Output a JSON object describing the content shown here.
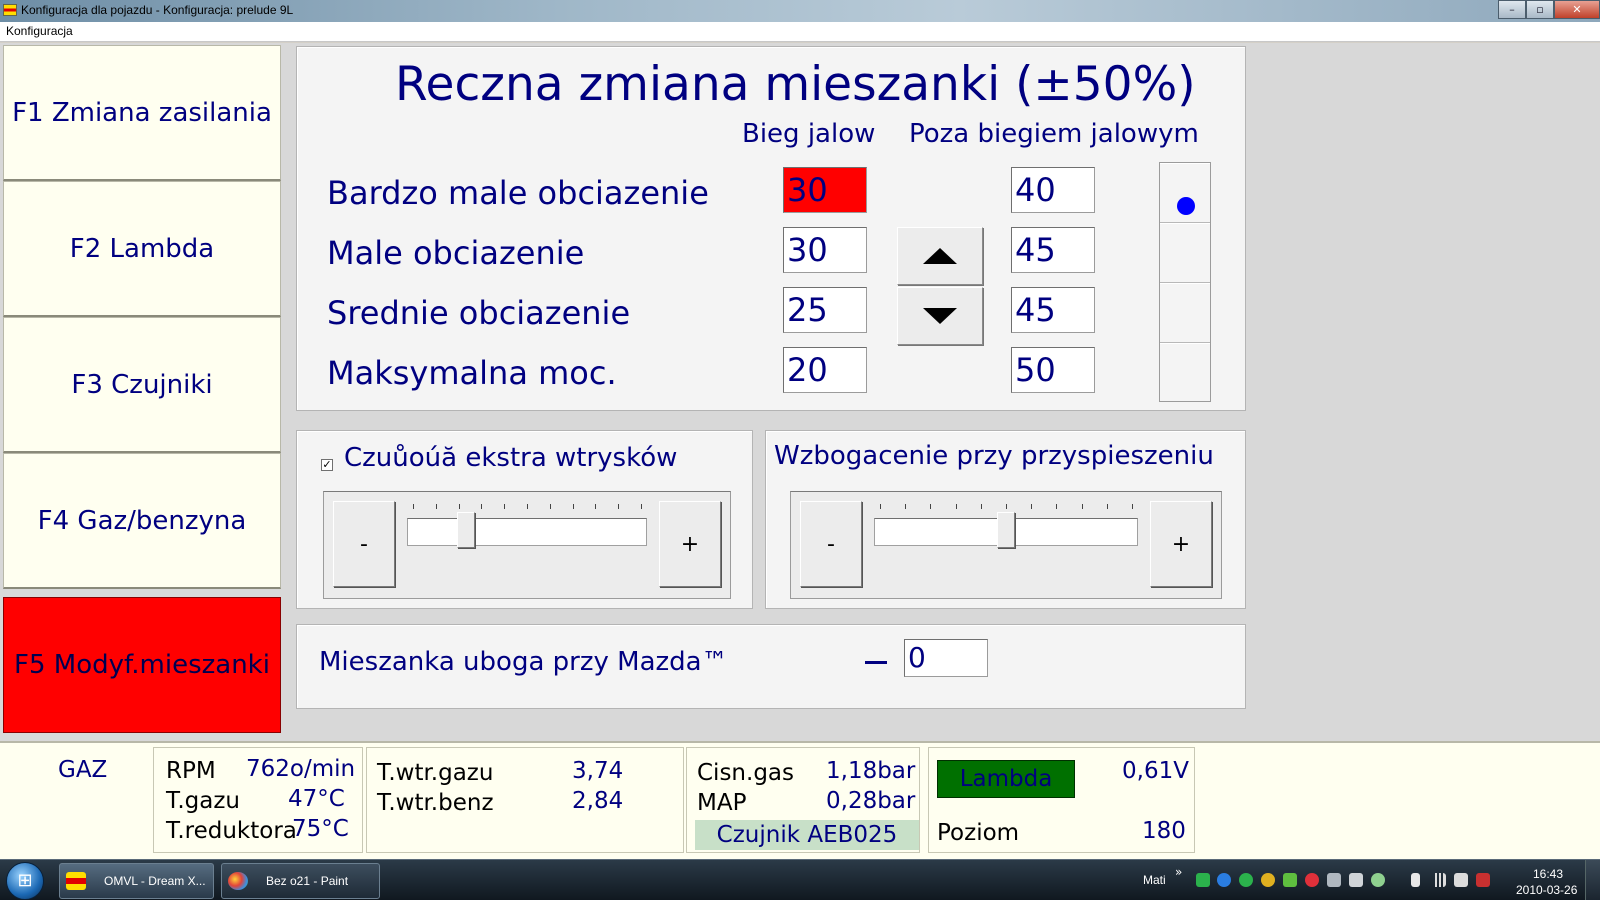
{
  "window": {
    "title": "Konfiguracja dla pojazdu - Konfiguracja: prelude 9L",
    "minimize_label": "–",
    "maximize_label": "▫",
    "close_label": "✕"
  },
  "menu": {
    "items": [
      "Konfiguracja"
    ]
  },
  "sidebar": {
    "items": [
      {
        "label": "F1 Zmiana zasilania",
        "active": false
      },
      {
        "label": "F2 Lambda",
        "active": false
      },
      {
        "label": "F3 Czujniki",
        "active": false
      },
      {
        "label": "F4 Gaz/benzyna",
        "active": false
      },
      {
        "label": "F5 Modyf.mieszanki",
        "active": true
      }
    ]
  },
  "mixture": {
    "title": "Reczna zmiana mieszanki (±50%)",
    "col_idle": "Bieg jalow",
    "col_offidle": "Poza biegiem jalowym",
    "rows": [
      {
        "label": "Bardzo male obciazenie",
        "idle": "30",
        "offidle": "40"
      },
      {
        "label": "Male obciazenie",
        "idle": "30",
        "offidle": "45"
      },
      {
        "label": "Srednie obciazenie",
        "idle": "25",
        "offidle": "45"
      },
      {
        "label": "Maksymalna moc.",
        "idle": "20",
        "offidle": "50"
      }
    ],
    "selected_row": 0,
    "highlight_color": "#ff0000"
  },
  "extra_injection": {
    "checkbox_mark": "✓",
    "label": "Czuůoúă ekstra wtrysków",
    "minus_label": "-",
    "plus_label": "+",
    "level": 0.25
  },
  "acceleration": {
    "label": "Wzbogacenie przy przyspieszeniu",
    "minus_label": "-",
    "plus_label": "+",
    "level": 0.5
  },
  "mazda": {
    "label": "Mieszanka uboga przy Mazda™",
    "value": "0"
  },
  "status": {
    "fuel": "GAZ",
    "rpm_label": "RPM",
    "rpm_value": "762o/min",
    "tgas_label": "T.gazu",
    "tgas_value": "47°C",
    "tred_label": "T.reduktora",
    "tred_value": "75°C",
    "inj_gas_label": "T.wtr.gazu",
    "inj_gas_value": "3,74",
    "inj_petrol_label": "T.wtr.benz",
    "inj_petrol_value": "2,84",
    "pgas_label": "Cisn.gas",
    "pgas_value": "1,18bar",
    "map_label": "MAP",
    "map_value": "0,28bar",
    "sensor_label": "Czujnik AEB025",
    "lambda_label": "Lambda",
    "lambda_value": "0,61V",
    "level_label": "Poziom",
    "level_value": "180"
  },
  "taskbar": {
    "start_icon": "⊞",
    "tasks": [
      {
        "label": "OMVL - Dream X...",
        "icon": "omvl-icon"
      },
      {
        "label": "Bez o21 - Paint",
        "icon": "paint-icon"
      }
    ],
    "user": "Mati",
    "chevron": "»",
    "time": "16:43",
    "date": "2010-03-26"
  }
}
